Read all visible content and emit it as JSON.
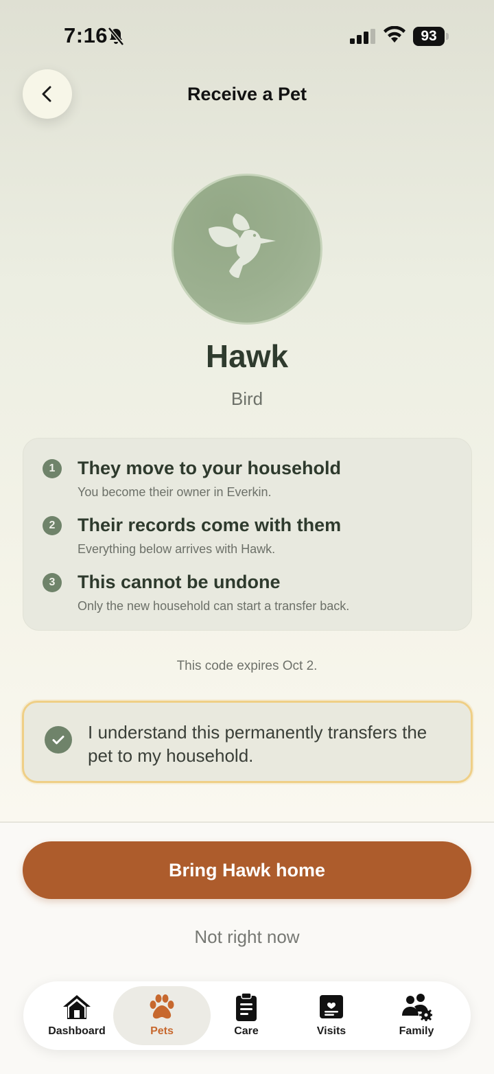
{
  "status_bar": {
    "time": "7:16",
    "battery": "93"
  },
  "header": {
    "title": "Receive a Pet"
  },
  "pet": {
    "name": "Hawk",
    "species": "Bird",
    "avatar_icon": "hummingbird-icon"
  },
  "steps": [
    {
      "number": "1",
      "title": "They move to your household",
      "subtitle": "You become their owner in Everkin."
    },
    {
      "number": "2",
      "title": "Their records come with them",
      "subtitle": "Everything below arrives with Hawk."
    },
    {
      "number": "3",
      "title": "This cannot be undone",
      "subtitle": "Only the new household can start a transfer back."
    }
  ],
  "expiry_note": "This code expires Oct 2.",
  "confirm": {
    "checked": true,
    "text": "I understand this permanently transfers the pet to my household."
  },
  "actions": {
    "primary": "Bring Hawk home",
    "secondary": "Not right now"
  },
  "tabs": [
    {
      "label": "Dashboard",
      "icon": "house-icon",
      "active": false
    },
    {
      "label": "Pets",
      "icon": "paw-icon",
      "active": true
    },
    {
      "label": "Care",
      "icon": "clipboard-icon",
      "active": false
    },
    {
      "label": "Visits",
      "icon": "heart-list-icon",
      "active": false
    },
    {
      "label": "Family",
      "icon": "people-gear-icon",
      "active": false
    }
  ],
  "colors": {
    "accent": "#ad5c2c",
    "sage": "#6f836a",
    "active_tab": "#c7682e",
    "confirm_border": "#efcf86"
  }
}
